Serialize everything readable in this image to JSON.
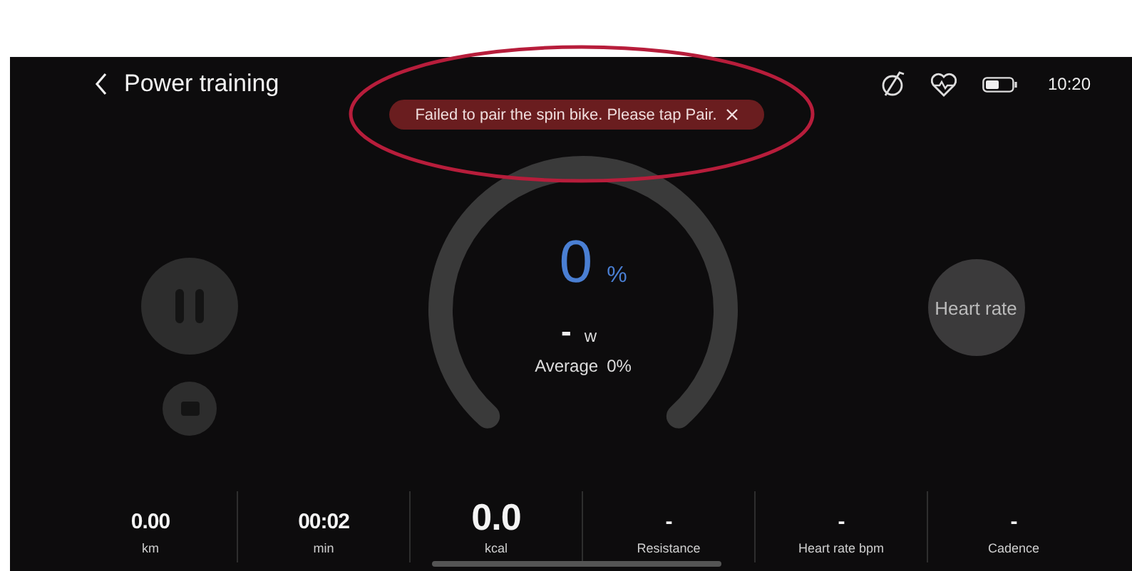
{
  "header": {
    "title": "Power training",
    "time": "10:20"
  },
  "toast": {
    "message": "Failed to pair the spin bike. Please tap Pair."
  },
  "annotation": {
    "kind": "ellipse"
  },
  "controls": [
    {
      "kind": "pause"
    },
    {
      "kind": "stop"
    }
  ],
  "gauge": {
    "value": "0",
    "unit": "%",
    "power": "-",
    "power_unit": "w",
    "average_label": "Average",
    "average_value": "0%"
  },
  "heart_rate_button": {
    "label": "Heart rate"
  },
  "stats": [
    {
      "value": "0.00",
      "label": "km",
      "emphasized": false
    },
    {
      "value": "00:02",
      "label": "min",
      "emphasized": false
    },
    {
      "value": "0.0",
      "label": "kcal",
      "emphasized": true
    },
    {
      "value": "-",
      "label": "Resistance",
      "emphasized": false
    },
    {
      "value": "-",
      "label": "Heart rate bpm",
      "emphasized": false
    },
    {
      "value": "-",
      "label": "Cadence",
      "emphasized": false
    }
  ]
}
